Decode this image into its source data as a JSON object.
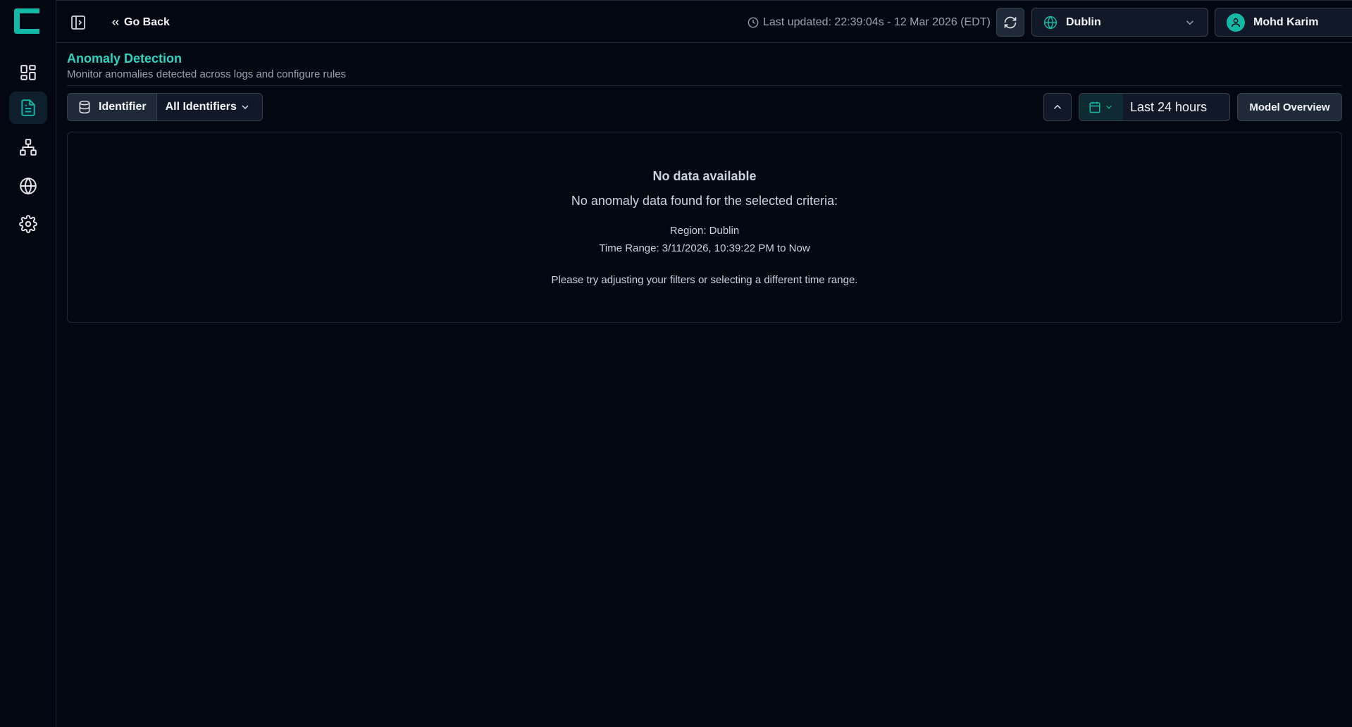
{
  "app": {
    "accent_color": "#2dd4bf"
  },
  "sidebar": {
    "items": [
      {
        "icon": "dashboard-icon",
        "active": false
      },
      {
        "icon": "document-icon",
        "active": true
      },
      {
        "icon": "hierarchy-icon",
        "active": false
      },
      {
        "icon": "globe-icon",
        "active": false
      },
      {
        "icon": "gear-icon",
        "active": false
      }
    ]
  },
  "topbar": {
    "go_back_label": "Go Back",
    "last_updated": "Last updated: 22:39:04s - 12 Mar 2026 (EDT)",
    "region": "Dublin",
    "user_name": "Mohd Karim"
  },
  "header": {
    "title": "Anomaly Detection",
    "subtitle": "Monitor anomalies detected across logs and configure rules"
  },
  "toolbar": {
    "identifier_label": "Identifier",
    "identifier_value": "All Identifiers",
    "time_range": "Last 24 hours",
    "model_overview_label": "Model Overview"
  },
  "empty_state": {
    "title": "No data available",
    "description": "No anomaly data found for the selected criteria:",
    "region_line": "Region: Dublin",
    "time_range_line": "Time Range: 3/11/2026, 10:39:22 PM to Now",
    "hint": "Please try adjusting your filters or selecting a different time range."
  }
}
